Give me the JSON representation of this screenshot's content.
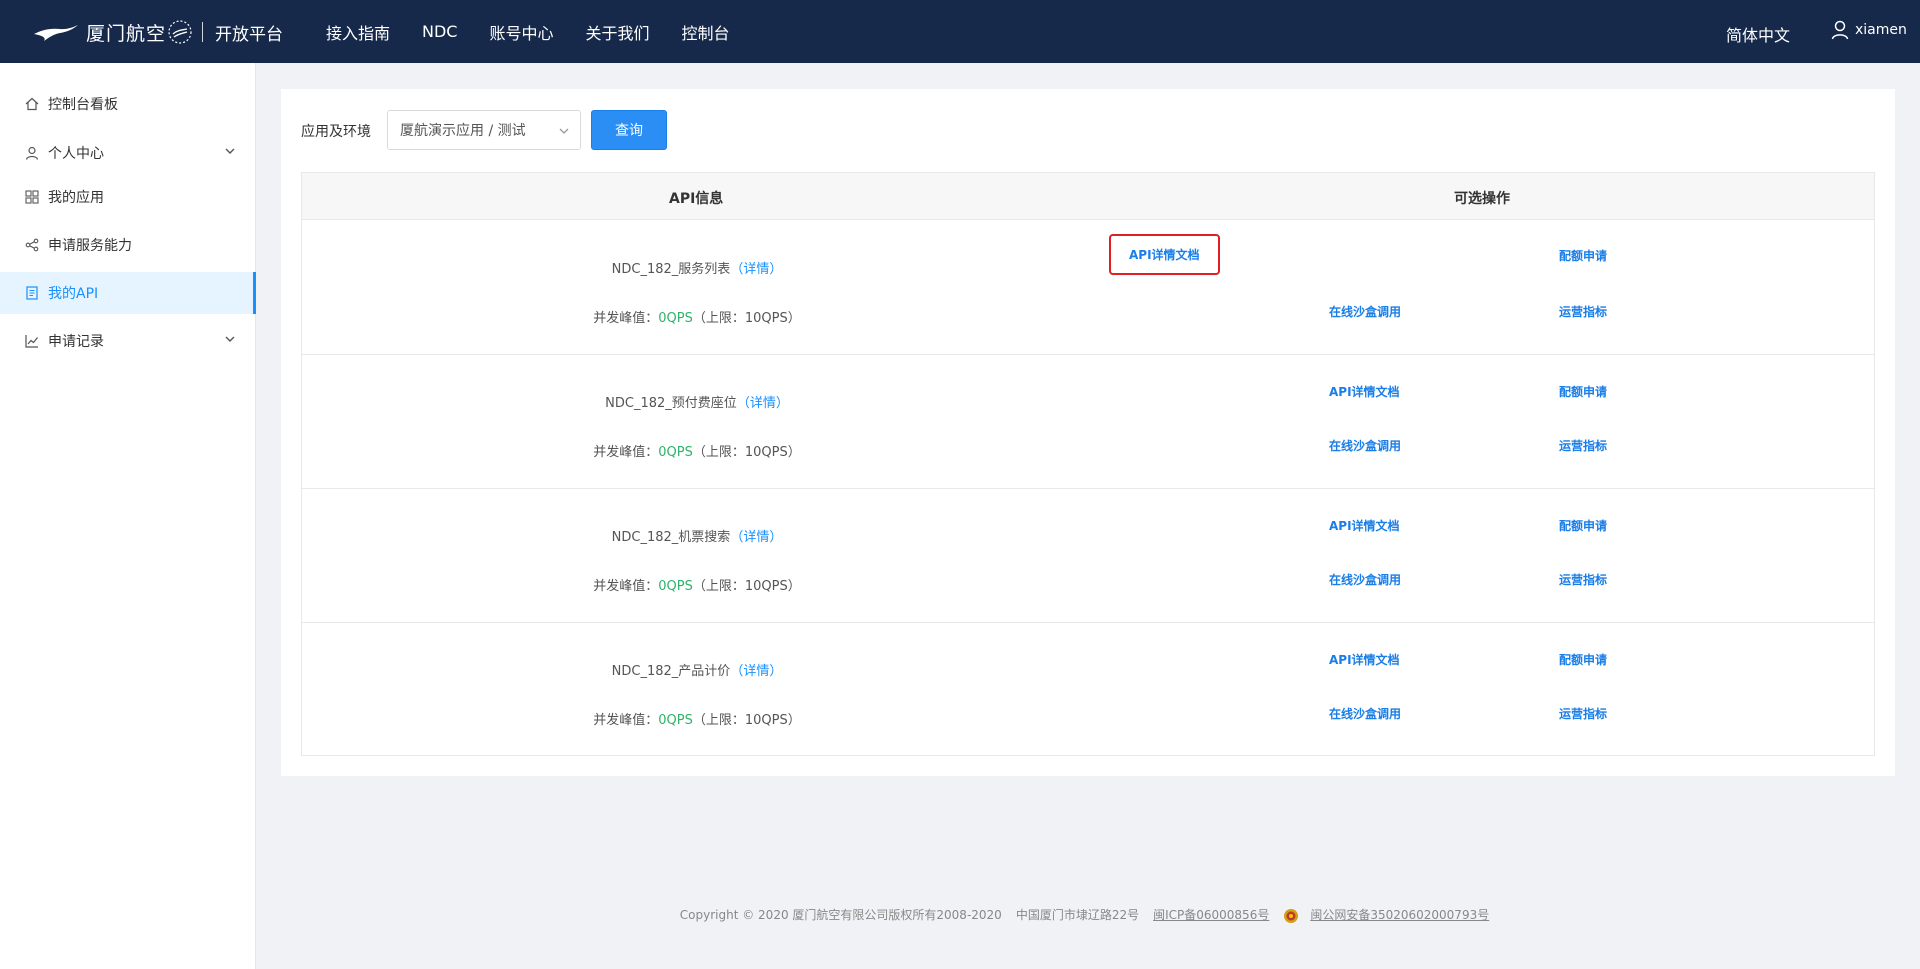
{
  "header": {
    "logo_text": "厦门航空",
    "platform_text": "开放平台",
    "nav": [
      "接入指南",
      "NDC",
      "账号中心",
      "关于我们",
      "控制台"
    ],
    "language": "简体中文",
    "username": "xiamen"
  },
  "sidebar": {
    "items": [
      {
        "label": "控制台看板",
        "icon": "home-icon"
      },
      {
        "label": "个人中心",
        "icon": "user-icon",
        "expandable": true
      },
      {
        "label": "我的应用",
        "icon": "grid-icon"
      },
      {
        "label": "申请服务能力",
        "icon": "share-icon"
      },
      {
        "label": "我的API",
        "icon": "document-icon",
        "active": true
      },
      {
        "label": "申请记录",
        "icon": "line-chart-icon",
        "expandable": true
      }
    ]
  },
  "filter": {
    "label": "应用及环境",
    "selected": "厦航演示应用 / 测试",
    "query_button": "查询"
  },
  "table": {
    "headers": {
      "api_info": "API信息",
      "operations": "可选操作"
    },
    "rows": [
      {
        "name": "NDC_182_服务列表",
        "detail": "（详情）",
        "qps_label": "并发峰值：",
        "qps_value": "0QPS",
        "limit": "（上限：10QPS）",
        "op1": "API详情文档",
        "op2": "配额申请",
        "op3": "在线沙盒调用",
        "op4": "运营指标"
      },
      {
        "name": "NDC_182_预付费座位",
        "detail": "（详情）",
        "qps_label": "并发峰值：",
        "qps_value": "0QPS",
        "limit": "（上限：10QPS）",
        "op1": "API详情文档",
        "op2": "配额申请",
        "op3": "在线沙盒调用",
        "op4": "运营指标"
      },
      {
        "name": "NDC_182_机票搜索",
        "detail": "（详情）",
        "qps_label": "并发峰值：",
        "qps_value": "0QPS",
        "limit": "（上限：10QPS）",
        "op1": "API详情文档",
        "op2": "配额申请",
        "op3": "在线沙盒调用",
        "op4": "运营指标"
      },
      {
        "name": "NDC_182_产品计价",
        "detail": "（详情）",
        "qps_label": "并发峰值：",
        "qps_value": "0QPS",
        "limit": "（上限：10QPS）",
        "op1": "API详情文档",
        "op2": "配额申请",
        "op3": "在线沙盒调用",
        "op4": "运营指标"
      }
    ]
  },
  "footer": {
    "copyright": "Copyright © 2020 厦门航空有限公司版权所有2008-2020",
    "address": "中国厦门市埭辽路22号",
    "icp": "闽ICP备06000856号",
    "police": "闽公网安备35020602000793号"
  },
  "colors": {
    "header_bg": "#16294a",
    "accent": "#1890ff",
    "qps_green": "#2fb36a",
    "highlight_red": "#e02020"
  }
}
